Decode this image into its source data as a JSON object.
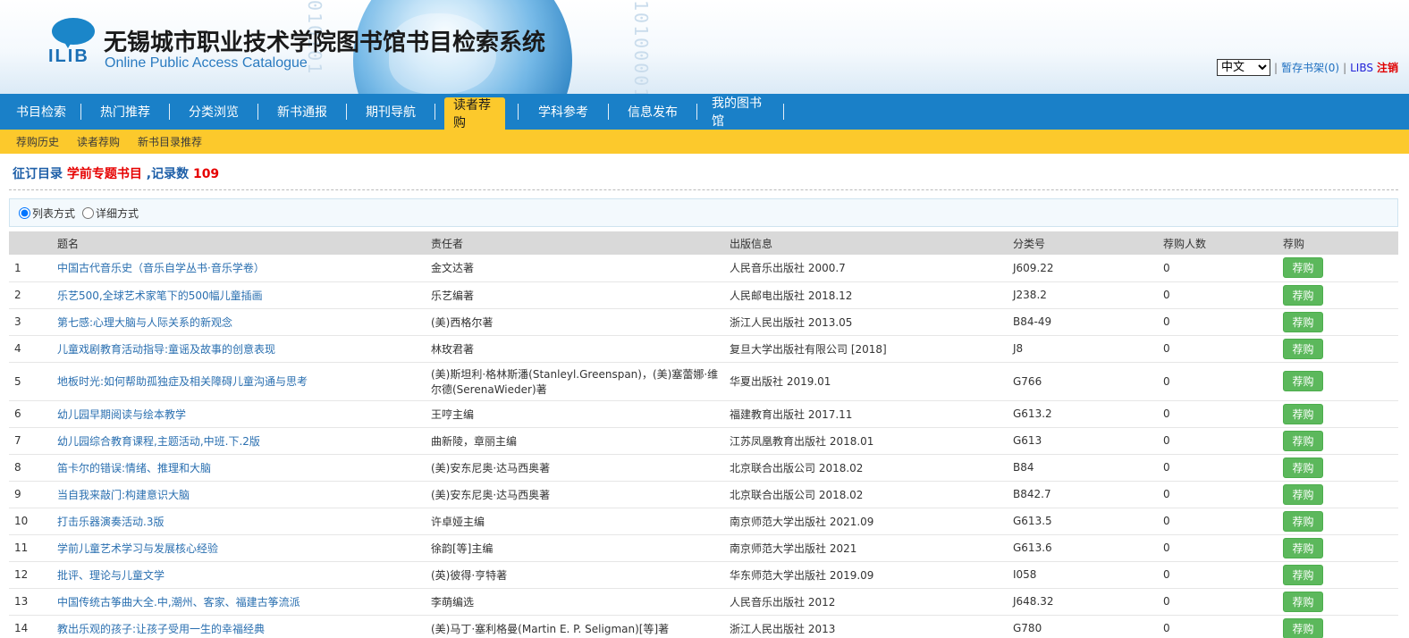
{
  "header": {
    "logo_text": "ILIB",
    "title": "无锡城市职业技术学院图书馆书目检索系统",
    "subtitle": "Online Public Access Catalogue",
    "binary_left": "010101",
    "binary_right": "10100001",
    "language_selected": "中文",
    "bookshelf_link": "暂存书架(0)",
    "libs_link": "LIBS",
    "logout_link": "注销",
    "separator": "|"
  },
  "mainnav": {
    "items": [
      {
        "label": "书目检索"
      },
      {
        "label": "热门推荐"
      },
      {
        "label": "分类浏览"
      },
      {
        "label": "新书通报"
      },
      {
        "label": "期刊导航"
      },
      {
        "label": "读者荐购",
        "active": true
      },
      {
        "label": "学科参考"
      },
      {
        "label": "信息发布"
      },
      {
        "label": "我的图书馆"
      }
    ]
  },
  "subnav": {
    "items": [
      {
        "label": "荐购历史"
      },
      {
        "label": "读者荐购"
      },
      {
        "label": "新书目录推荐"
      }
    ]
  },
  "crumb": {
    "prefix": "征订目录",
    "topic": "学前专题书目",
    "count_label": ",记录数",
    "count": "109"
  },
  "viewbar": {
    "list_mode": "列表方式",
    "detail_mode": "详细方式"
  },
  "table": {
    "columns": [
      "",
      "题名",
      "责任者",
      "出版信息",
      "分类号",
      "荐购人数",
      "荐购"
    ],
    "button_label": "荐购",
    "rows": [
      {
        "no": "1",
        "title": "中国古代音乐史（音乐自学丛书·音乐学卷）",
        "author": "金文达著",
        "pub": "人民音乐出版社 2000.7",
        "class": "J609.22",
        "count": "0"
      },
      {
        "no": "2",
        "title": "乐艺500,全球艺术家笔下的500幅儿童插画",
        "author": "乐艺编著",
        "pub": "人民邮电出版社 2018.12",
        "class": "J238.2",
        "count": "0"
      },
      {
        "no": "3",
        "title": "第七感:心理大脑与人际关系的新观念",
        "author": "(美)西格尔著",
        "pub": "浙江人民出版社 2013.05",
        "class": "B84-49",
        "count": "0"
      },
      {
        "no": "4",
        "title": "儿童戏剧教育活动指导:童谣及故事的创意表现",
        "author": "林玫君著",
        "pub": "复旦大学出版社有限公司 [2018]",
        "class": "J8",
        "count": "0"
      },
      {
        "no": "5",
        "title": "地板时光:如何帮助孤独症及相关障碍儿童沟通与思考",
        "author": "(美)斯坦利·格林斯潘(Stanleyl.Greenspan)，(美)塞蕾娜·维尔德(SerenaWieder)著",
        "pub": "华夏出版社 2019.01",
        "class": "G766",
        "count": "0",
        "tall": true
      },
      {
        "no": "6",
        "title": "幼儿园早期阅读与绘本教学",
        "author": "王哼主编",
        "pub": "福建教育出版社 2017.11",
        "class": "G613.2",
        "count": "0"
      },
      {
        "no": "7",
        "title": "幼儿园综合教育课程,主题活动,中班.下.2版",
        "author": "曲新陵，章丽主编",
        "pub": "江苏凤凰教育出版社 2018.01",
        "class": "G613",
        "count": "0"
      },
      {
        "no": "8",
        "title": "笛卡尔的错误:情绪、推理和大脑",
        "author": "(美)安东尼奥·达马西奥著",
        "pub": "北京联合出版公司 2018.02",
        "class": "B84",
        "count": "0"
      },
      {
        "no": "9",
        "title": "当自我来敲门:构建意识大脑",
        "author": "(美)安东尼奥·达马西奥著",
        "pub": "北京联合出版公司 2018.02",
        "class": "B842.7",
        "count": "0"
      },
      {
        "no": "10",
        "title": "打击乐器演奏活动.3版",
        "author": "许卓娅主编",
        "pub": "南京师范大学出版社 2021.09",
        "class": "G613.5",
        "count": "0"
      },
      {
        "no": "11",
        "title": "学前儿童艺术学习与发展核心经验",
        "author": "徐韵[等]主编",
        "pub": "南京师范大学出版社 2021",
        "class": "G613.6",
        "count": "0"
      },
      {
        "no": "12",
        "title": "批评、理论与儿童文学",
        "author": "(英)彼得·亨特著",
        "pub": "华东师范大学出版社 2019.09",
        "class": "I058",
        "count": "0"
      },
      {
        "no": "13",
        "title": "中国传统古筝曲大全.中,潮州、客家、福建古筝流派",
        "author": "李萌编选",
        "pub": "人民音乐出版社 2012",
        "class": "J648.32",
        "count": "0"
      },
      {
        "no": "14",
        "title": "教出乐观的孩子:让孩子受用一生的幸福经典",
        "author": "(美)马丁·塞利格曼(Martin E. P. Seligman)[等]著",
        "pub": "浙江人民出版社 2013",
        "class": "G780",
        "count": "0"
      }
    ]
  },
  "colors": {
    "nav_blue": "#1a80c8",
    "nav_yellow": "#fcc92c",
    "button_green": "#5cb85c",
    "link_blue": "#2a6fb0",
    "alert_red": "#e60000"
  }
}
